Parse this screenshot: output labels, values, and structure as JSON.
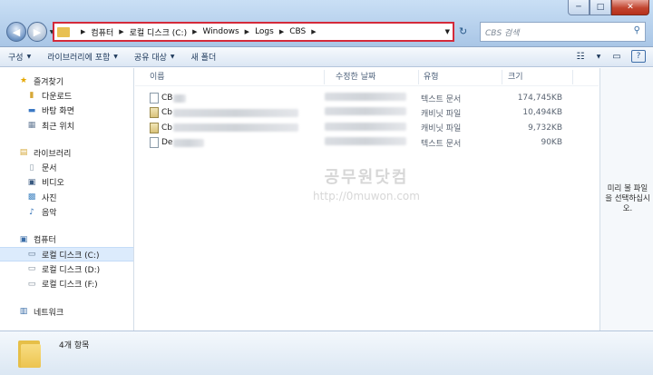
{
  "window": {
    "minimize": "─",
    "maximize": "□",
    "close": "✕"
  },
  "nav": {
    "back": "◀",
    "forward": "▶",
    "dropdown": "▼"
  },
  "address": {
    "crumbs": [
      "컴퓨터",
      "로컬 디스크 (C:)",
      "Windows",
      "Logs",
      "CBS"
    ],
    "refresh": "↻"
  },
  "search": {
    "placeholder": "CBS 검색",
    "icon": "search-icon"
  },
  "toolbar": {
    "items": [
      {
        "label": "구성",
        "has_caret": true
      },
      {
        "label": "라이브러리에 포함",
        "has_caret": true
      },
      {
        "label": "공유 대상",
        "has_caret": true
      },
      {
        "label": "새 폴더",
        "has_caret": false
      }
    ]
  },
  "navpane": {
    "favorites": {
      "label": "즐겨찾기",
      "items": [
        "다운로드",
        "바탕 화면",
        "최근 위치"
      ]
    },
    "libraries": {
      "label": "라이브러리",
      "items": [
        "문서",
        "비디오",
        "사진",
        "음악"
      ]
    },
    "computer": {
      "label": "컴퓨터",
      "items": [
        "로컬 디스크 (C:)",
        "로컬 디스크 (D:)",
        "로컬 디스크 (F:)"
      ],
      "selected": 0
    },
    "network": {
      "label": "네트워크"
    }
  },
  "columns": [
    "이름",
    "수정한 날짜",
    "유형",
    "크기"
  ],
  "files": [
    {
      "name": "CB",
      "type": "텍스트 문서",
      "size": "174,745KB",
      "icon": "text"
    },
    {
      "name": "Cb",
      "type": "캐비닛 파일",
      "size": "10,494KB",
      "icon": "cab"
    },
    {
      "name": "Cb",
      "type": "캐비닛 파일",
      "size": "9,732KB",
      "icon": "cab"
    },
    {
      "name": "De",
      "type": "텍스트 문서",
      "size": "90KB",
      "icon": "text"
    }
  ],
  "watermark": {
    "line1": "공무원닷컴",
    "line2": "http://0muwon.com"
  },
  "preview": {
    "text": "미리 볼 파일을 선택하십시오."
  },
  "status": {
    "item_count": "4개 항목"
  }
}
